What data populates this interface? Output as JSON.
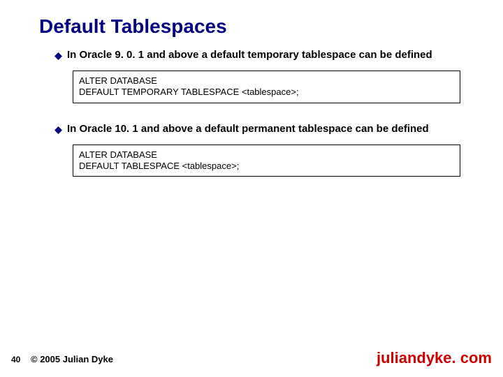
{
  "title": "Default Tablespaces",
  "bullets": [
    {
      "text": "In Oracle 9. 0. 1 and above a default temporary tablespace can be defined",
      "code": [
        "ALTER DATABASE",
        "DEFAULT TEMPORARY TABLESPACE <tablespace>;"
      ]
    },
    {
      "text": "In Oracle 10. 1 and above a default permanent tablespace can be defined",
      "code": [
        "ALTER DATABASE",
        "DEFAULT TABLESPACE <tablespace>;"
      ]
    }
  ],
  "footer": {
    "page_number": "40",
    "copyright": "© 2005 Julian Dyke",
    "site": "juliandyke. com"
  }
}
